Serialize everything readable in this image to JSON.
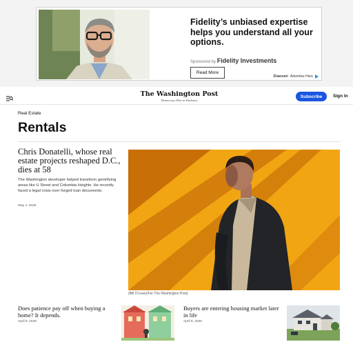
{
  "ad": {
    "headline": "Fidelity’s unbiased expertise helps you understand all your options.",
    "sponsored_by": "Sponsored by",
    "sponsor_name": "Fidelity Investments",
    "cta_label": "Read More",
    "network_name": "Dianomi",
    "advertise_label": "Advertise Here"
  },
  "header": {
    "masthead": "The Washington Post",
    "tagline": "Democracy Dies in Darkness",
    "subscribe_label": "Subscribe",
    "signin_label": "Sign In",
    "accent_color": "#1955e0"
  },
  "section": {
    "label": "Real Estate",
    "title": "Rentals"
  },
  "lead_story": {
    "headline": "Chris Donatelli, whose real estate projects reshaped D.C., dies at 58",
    "blurb": "The Washington developer helped transform gentrifying areas like U Street and Columbia Heights. He recently faced a legal crisis over forged loan documents.",
    "date": "May 4, 2026",
    "photo_caption": "(Bill O'Leary/For The Washington Post)"
  },
  "stories": [
    {
      "headline": "Does patience pay off when buying a home? It depends.",
      "date": "April 9, 2026"
    },
    {
      "headline": "Buyers are entering housing market later in life",
      "date": "April 9, 2026"
    }
  ]
}
